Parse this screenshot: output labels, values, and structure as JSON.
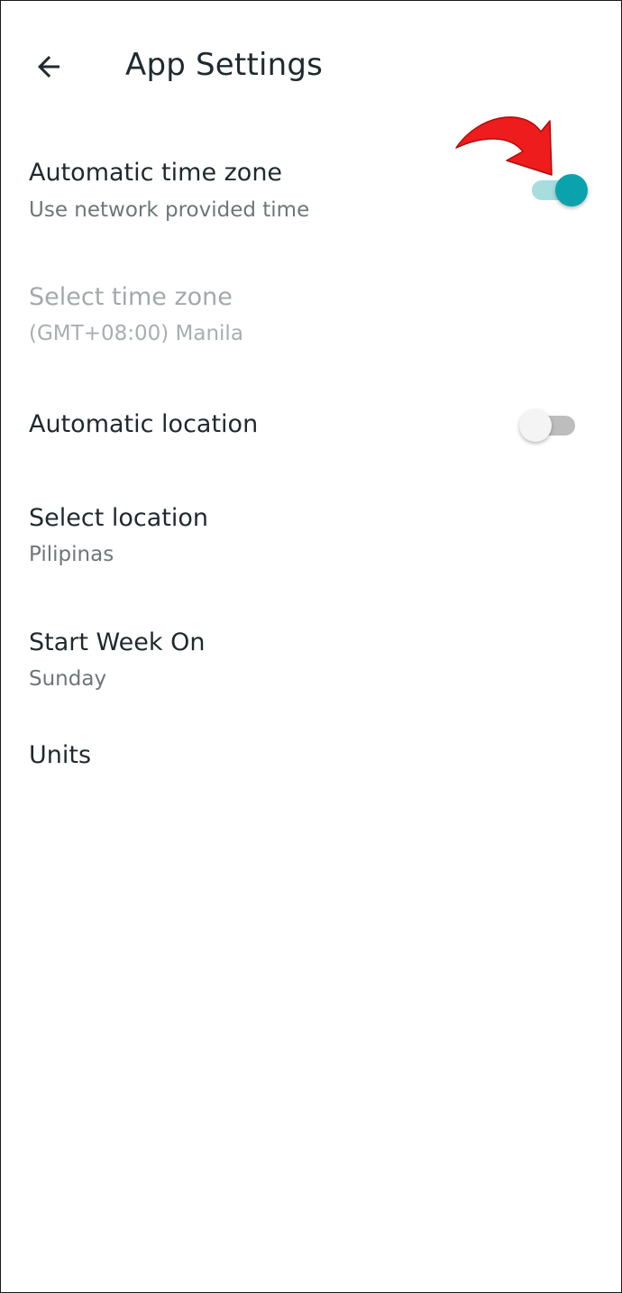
{
  "header": {
    "title": "App Settings",
    "back_icon": "arrow-left-icon"
  },
  "settings": [
    {
      "title": "Automatic time zone",
      "subtitle": "Use network provided time",
      "toggle": true,
      "enabled": true
    },
    {
      "title": "Select time zone",
      "subtitle": "(GMT+08:00) Manila",
      "enabled": false
    },
    {
      "title": "Automatic location",
      "toggle": false,
      "enabled": true
    },
    {
      "title": "Select location",
      "subtitle": "Pilipinas",
      "enabled": true
    },
    {
      "title": "Start Week On",
      "subtitle": "Sunday",
      "enabled": true
    },
    {
      "title": "Units",
      "enabled": true
    }
  ],
  "annotation": {
    "icon": "curved-arrow-icon",
    "color": "#ee1c1c"
  },
  "colors": {
    "accent": "#0aa3ad",
    "accent_track": "#a7dddf",
    "text_primary": "#1f2a2e",
    "text_secondary": "#6f7679",
    "text_disabled": "#a3a9ab"
  }
}
